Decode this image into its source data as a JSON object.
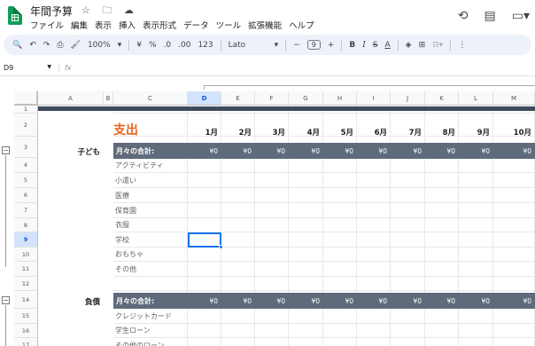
{
  "app": {
    "title": "年間予算",
    "title_icons": "☆ 🗀 ☁",
    "menu": [
      "ファイル",
      "編集",
      "表示",
      "挿入",
      "表示形式",
      "データ",
      "ツール",
      "拡張機能",
      "ヘルプ"
    ],
    "right_icons": [
      "history-icon",
      "comment-icon",
      "video-icon"
    ]
  },
  "toolbar": {
    "zoom": "100%",
    "currency": "¥",
    "percent": "%",
    "decimal_dec": ".0",
    "decimal_inc": ".00",
    "format_123": "123",
    "font": "Lato",
    "font_size": "9",
    "bold": "B",
    "italic": "I",
    "strike": "S",
    "text_color": "A"
  },
  "formula_bar": {
    "cell_ref": "D9",
    "fx": "fx",
    "value": ""
  },
  "columns": [
    "A",
    "B",
    "C",
    "D",
    "E",
    "F",
    "G",
    "H",
    "I",
    "J",
    "K",
    "L",
    "M"
  ],
  "rows": [
    "1",
    "2",
    "3",
    "4",
    "5",
    "6",
    "7",
    "8",
    "9",
    "10",
    "11",
    "12",
    "14",
    "15",
    "16",
    "17"
  ],
  "sheet": {
    "heading": "支出",
    "months": [
      "1月",
      "2月",
      "3月",
      "4月",
      "5月",
      "6月",
      "7月",
      "8月",
      "9月",
      "10月"
    ],
    "categories": [
      {
        "name": "子ども",
        "total_label": "月々の合計:",
        "totals": [
          "¥0",
          "¥0",
          "¥0",
          "¥0",
          "¥0",
          "¥0",
          "¥0",
          "¥0",
          "¥0",
          "¥0"
        ],
        "items": [
          "アクティビティ",
          "小遣い",
          "医療",
          "保育園",
          "衣服",
          "学校",
          "おもちゃ",
          "その他"
        ]
      },
      {
        "name": "負債",
        "total_label": "月々の合計:",
        "totals": [
          "¥0",
          "¥0",
          "¥0",
          "¥0",
          "¥0",
          "¥0",
          "¥0",
          "¥0",
          "¥0",
          "¥0"
        ],
        "items": [
          "クレジットカード",
          "学生ローン",
          "その他のローン"
        ]
      }
    ]
  },
  "colors": {
    "band": "#5f6b7a",
    "heading": "#e8631c",
    "selection": "#1a73e8",
    "frozen": "#3d4b5c"
  }
}
